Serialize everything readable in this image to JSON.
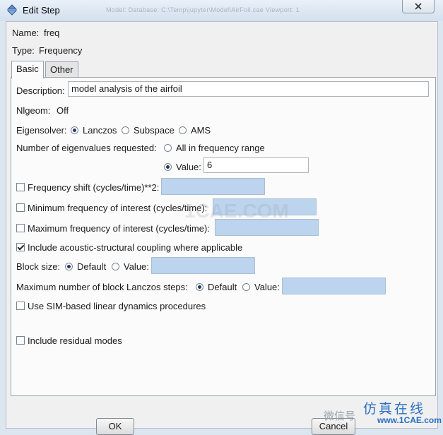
{
  "window": {
    "title": "Edit Step",
    "background_title": "Model: Database: C:\\Temp\\jupyter\\Model\\AirFoil.cae  Viewport: 1"
  },
  "step": {
    "name_label": "Name:",
    "name_value": "freq",
    "type_label": "Type:",
    "type_value": "Frequency"
  },
  "tabs": [
    {
      "label": "Basic",
      "active": true
    },
    {
      "label": "Other",
      "active": false
    }
  ],
  "basic": {
    "description_label": "Description:",
    "description_value": "model analysis of the airfoil",
    "nlgeom_label": "Nlgeom:",
    "nlgeom_value": "Off",
    "eigensolver_label": "Eigensolver:",
    "eigensolver_options": [
      "Lanczos",
      "Subspace",
      "AMS"
    ],
    "eigensolver_selected": "Lanczos",
    "num_eigen_label": "Number of eigenvalues requested:",
    "num_eigen_option_all": "All in frequency range",
    "num_eigen_option_value": "Value:",
    "num_eigen_selected": "Value:",
    "num_eigen_value": "6",
    "freq_shift_label": "Frequency shift (cycles/time)**2:",
    "freq_shift_checked": false,
    "freq_shift_value": "",
    "min_freq_label": "Minimum frequency of interest (cycles/time):",
    "min_freq_checked": false,
    "min_freq_value": "",
    "max_freq_label": "Maximum frequency of interest (cycles/time):",
    "max_freq_checked": false,
    "max_freq_value": "",
    "acoustic_label": "Include acoustic-structural coupling where applicable",
    "acoustic_checked": true,
    "block_size_label": "Block size:",
    "block_size_default": "Default",
    "block_size_value_label": "Value:",
    "block_size_selected": "Default",
    "block_size_value": "",
    "lanczos_steps_label": "Maximum number of block Lanczos steps:",
    "lanczos_steps_default": "Default",
    "lanczos_steps_value_label": "Value:",
    "lanczos_steps_selected": "Default",
    "lanczos_steps_value": "",
    "sim_label": "Use SIM-based linear dynamics procedures",
    "sim_checked": false,
    "residual_label": "Include residual modes",
    "residual_checked": false
  },
  "buttons": {
    "ok": "OK",
    "cancel": "Cancel"
  },
  "watermark": {
    "center": "1CAE.COM",
    "wechat": "微信号",
    "logo_cn": "仿真在线",
    "logo_en": "www.1CAE.com"
  },
  "colors": {
    "field_blue": "#bcd4ee",
    "logo_blue": "#2a6fc0"
  },
  "icons": {
    "app": "edit-step-icon",
    "close": "close-icon"
  }
}
